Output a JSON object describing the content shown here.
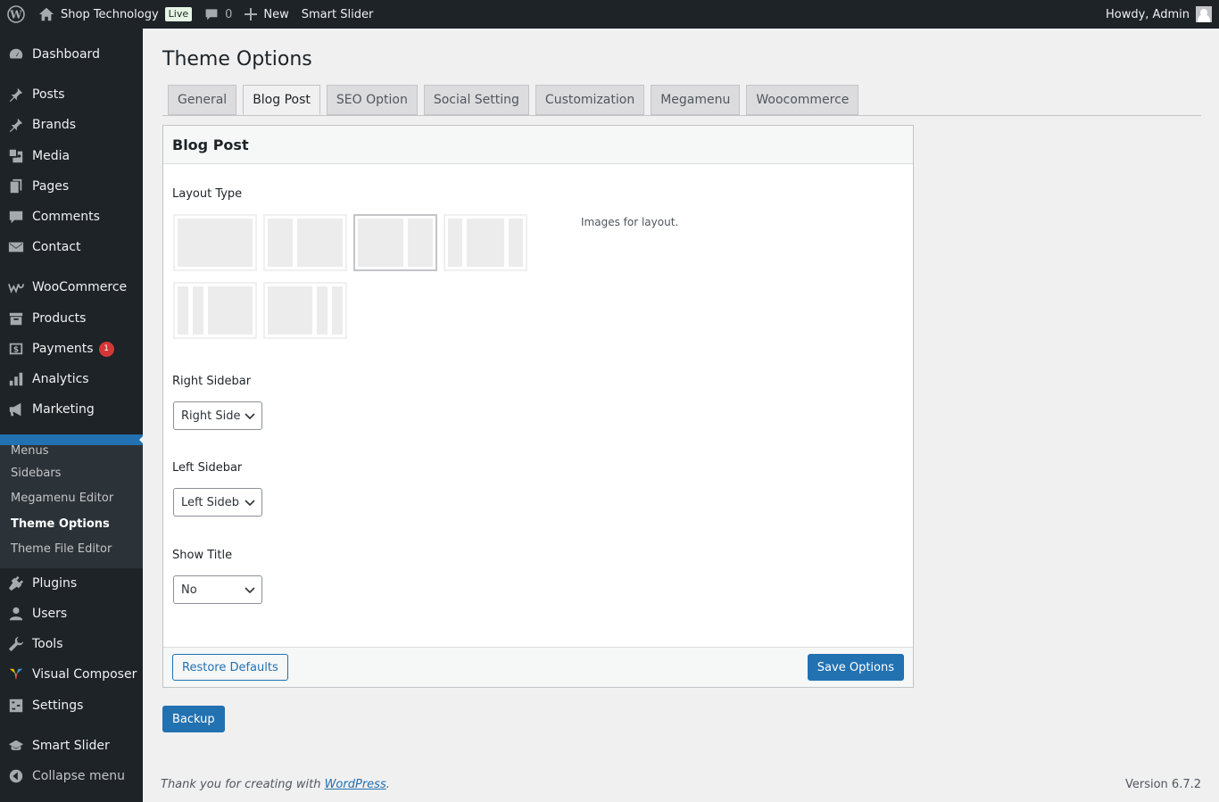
{
  "adminbar": {
    "site_name": "Shop Technology",
    "live_label": "Live",
    "comments_count": "0",
    "new_label": "New",
    "smart_slider_label": "Smart Slider",
    "howdy": "Howdy, Admin"
  },
  "sidebar": {
    "items": [
      {
        "label": "Dashboard",
        "icon": "dashboard-icon"
      },
      {
        "label": "Posts",
        "icon": "pin-icon"
      },
      {
        "label": "Brands",
        "icon": "pin-icon"
      },
      {
        "label": "Media",
        "icon": "media-icon"
      },
      {
        "label": "Pages",
        "icon": "pages-icon"
      },
      {
        "label": "Comments",
        "icon": "comment-icon"
      },
      {
        "label": "Contact",
        "icon": "mail-icon"
      },
      {
        "label": "WooCommerce",
        "icon": "woo-icon"
      },
      {
        "label": "Products",
        "icon": "archive-icon"
      },
      {
        "label": "Payments",
        "icon": "dollar-icon",
        "badge": "1"
      },
      {
        "label": "Analytics",
        "icon": "chart-icon"
      },
      {
        "label": "Marketing",
        "icon": "megaphone-icon"
      },
      {
        "label": "Plugins",
        "icon": "plug-icon"
      },
      {
        "label": "Users",
        "icon": "user-icon"
      },
      {
        "label": "Tools",
        "icon": "wrench-icon"
      },
      {
        "label": "Visual Composer",
        "icon": "vc-icon"
      },
      {
        "label": "Settings",
        "icon": "settings-icon"
      },
      {
        "label": "Smart Slider",
        "icon": "slider-icon"
      },
      {
        "label": "Collapse menu",
        "icon": "collapse-icon"
      }
    ],
    "submenu": [
      "Menus",
      "Sidebars",
      "Megamenu Editor",
      "Theme Options",
      "Theme File Editor"
    ]
  },
  "page": {
    "title": "Theme Options",
    "tabs": [
      "General",
      "Blog Post",
      "SEO Option",
      "Social Setting",
      "Customization",
      "Megamenu",
      "Woocommerce"
    ],
    "active_tab": "Blog Post"
  },
  "panel": {
    "heading": "Blog Post",
    "layout_label": "Layout Type",
    "layout_help": "Images for layout.",
    "right_sidebar_label": "Right Sidebar",
    "right_sidebar_value": "Right Sidebar",
    "left_sidebar_label": "Left Sidebar",
    "left_sidebar_value": "Left Sidebar",
    "show_title_label": "Show Title",
    "show_title_value": "No",
    "restore_label": "Restore Defaults",
    "save_label": "Save Options"
  },
  "backup_label": "Backup",
  "footer": {
    "thanks_prefix": "Thank you for creating with ",
    "thanks_link": "WordPress",
    "thanks_suffix": ".",
    "version": "Version 6.7.2"
  },
  "colors": {
    "admin_bg": "#1d2327",
    "accent": "#2271b1",
    "badge": "#d63638"
  }
}
